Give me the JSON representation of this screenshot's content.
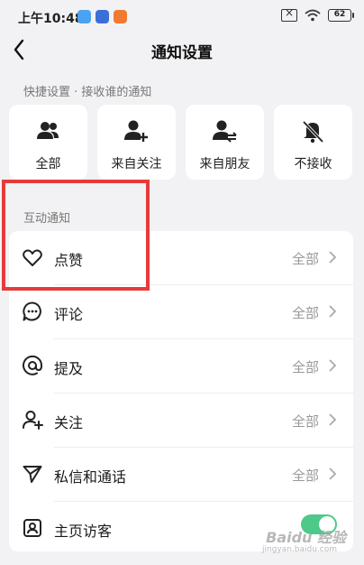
{
  "status_bar": {
    "time": "上午10:48",
    "battery": "62",
    "app_colors": [
      "#4aa3f0",
      "#3a6fd8",
      "#f07a32"
    ]
  },
  "header": {
    "title": "通知设置"
  },
  "quick_settings": {
    "label": "快捷设置 · 接收谁的通知",
    "items": [
      {
        "label": "全部",
        "icon": "users-icon"
      },
      {
        "label": "来自关注",
        "icon": "user-plus-icon"
      },
      {
        "label": "来自朋友",
        "icon": "user-swap-icon"
      },
      {
        "label": "不接收",
        "icon": "bell-off-icon"
      }
    ]
  },
  "interaction": {
    "label": "互动通知",
    "rows": [
      {
        "label": "点赞",
        "value": "全部",
        "icon": "heart-icon"
      },
      {
        "label": "评论",
        "value": "全部",
        "icon": "comment-icon"
      },
      {
        "label": "提及",
        "value": "全部",
        "icon": "at-icon"
      },
      {
        "label": "关注",
        "value": "全部",
        "icon": "user-plus-icon"
      },
      {
        "label": "私信和通话",
        "value": "全部",
        "icon": "send-icon"
      },
      {
        "label": "主页访客",
        "toggle": true,
        "icon": "profile-icon"
      }
    ]
  },
  "accent_color": "#4ec98a",
  "highlight_color": "#e73b3b",
  "watermark": {
    "text": "Baidu 经验",
    "sub": "jingyan.baidu.com"
  }
}
